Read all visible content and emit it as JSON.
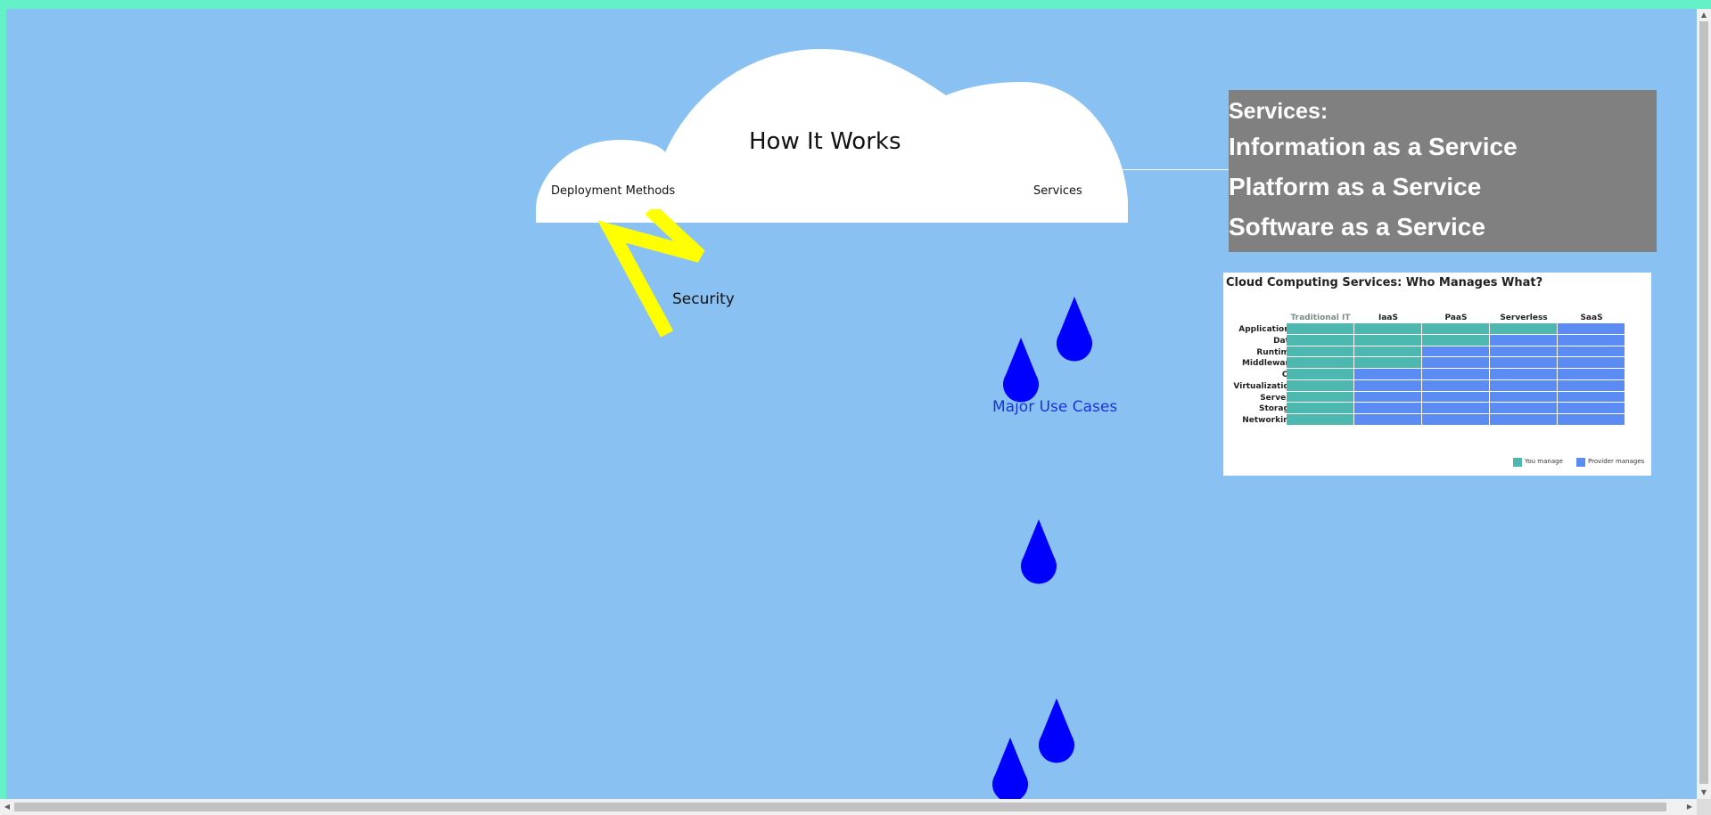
{
  "colors": {
    "frame": "#64f1c7",
    "sky": "#89c2f2",
    "cloud": "#ffffff",
    "panel": "#808080",
    "lightning": "#ffff00",
    "drop": "#0000ff",
    "use_cases_text": "#1a35d6",
    "you_manage": "#4cb8b0",
    "provider_manages": "#5b8cf4"
  },
  "cloud": {
    "title": "How It Works",
    "left_link": "Deployment Methods",
    "right_link": "Services"
  },
  "services_panel": {
    "heading": "Services:",
    "items": [
      "Information as a Service",
      "Platform as a Service",
      "Software as a Service"
    ]
  },
  "lightning": {
    "label": "Security"
  },
  "rain": {
    "label": "Major Use Cases"
  },
  "matrix": {
    "title": "Cloud Computing Services: Who Manages What?",
    "columns": [
      "Traditional IT",
      "IaaS",
      "PaaS",
      "Serverless",
      "SaaS"
    ],
    "rows": [
      "Applications",
      "Data",
      "Runtime",
      "Middleware",
      "OS",
      "Virtualization",
      "Servers",
      "Storage",
      "Networking"
    ],
    "you_manage_count": [
      9,
      4,
      2,
      1,
      0
    ],
    "legend": [
      "You manage",
      "Provider manages"
    ]
  },
  "icons": {
    "scroll_up": "triangle-up-icon",
    "scroll_down": "triangle-down-icon",
    "scroll_left": "triangle-left-icon",
    "scroll_right": "triangle-right-icon"
  }
}
